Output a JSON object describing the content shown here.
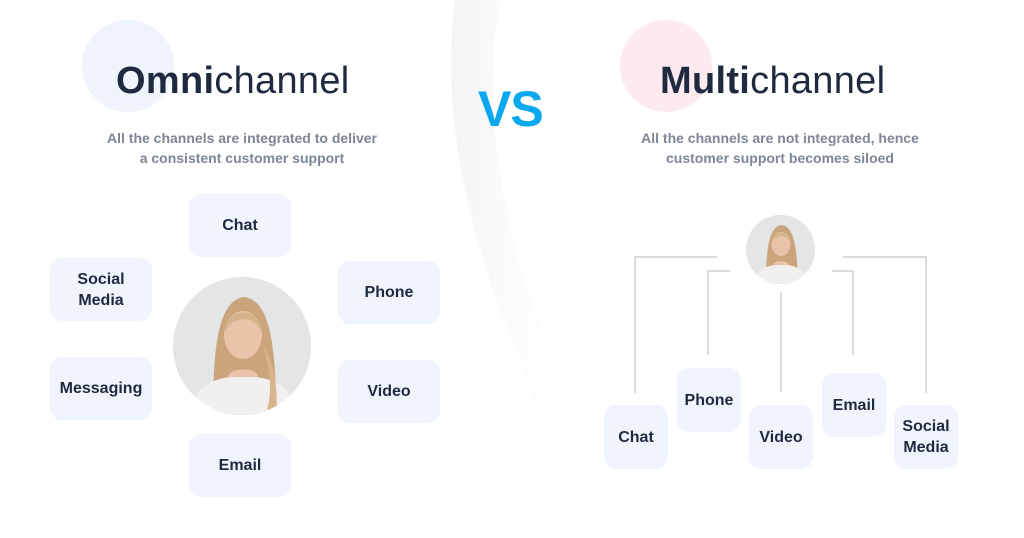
{
  "divider": {
    "label": "VS",
    "color": "#0aa8ef"
  },
  "omnichannel": {
    "title_bold": "Omni",
    "title_light": "channel",
    "accent_circle_color": "#eef3fc",
    "subtitle_line1": "All the channels are integrated to deliver",
    "subtitle_line2": "a consistent customer support",
    "center": "customer-support-agent-photo",
    "channels": [
      "Chat",
      "Phone",
      "Video",
      "Email",
      "Messaging",
      "Social Media"
    ]
  },
  "multichannel": {
    "title_bold": "Multi",
    "title_light": "channel",
    "accent_circle_color": "#fdeaee",
    "subtitle_line1": "All the channels are not integrated, hence",
    "subtitle_line2": "customer support becomes siloed",
    "center": "customer-support-agent-photo",
    "channels": [
      "Chat",
      "Phone",
      "Video",
      "Email",
      "Social Media"
    ]
  }
}
